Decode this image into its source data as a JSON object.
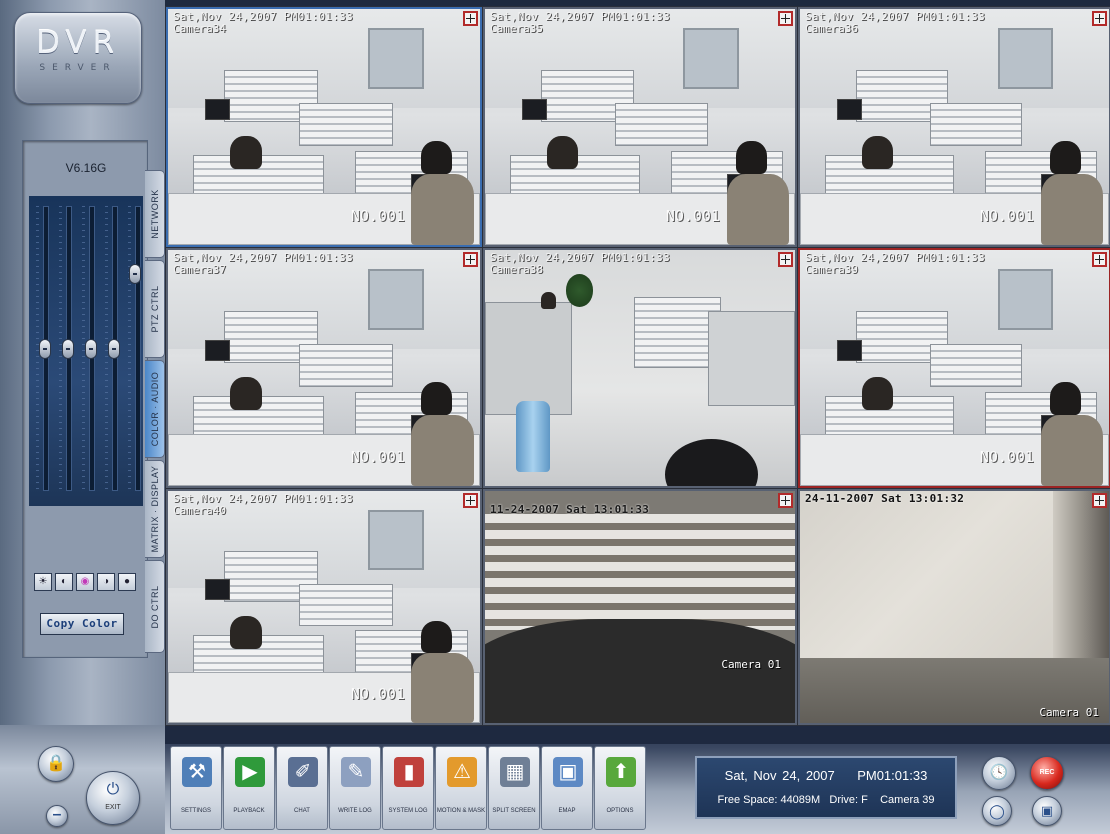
{
  "app": {
    "logo": {
      "title": "DVR",
      "subtitle": "SERVER"
    },
    "version": "V6.16G",
    "copy_color_label": "Copy Color"
  },
  "side_tabs": [
    {
      "label": "NETWORK"
    },
    {
      "label": "PTZ CTRL"
    },
    {
      "label": "COLOR · AUDIO",
      "active": true
    },
    {
      "label": "MATRIX · DISPLAY"
    },
    {
      "label": "DO CTRL"
    }
  ],
  "color_controls": [
    "brightness-icon",
    "contrast-icon",
    "hue-icon",
    "saturation-icon",
    "sharpness-icon"
  ],
  "sliders": {
    "brightness": 0.5,
    "contrast": 0.5,
    "saturation": 0.5,
    "hue": 0.5,
    "volume": 0.78
  },
  "cameras": [
    {
      "time": "Sat,Nov 24,2007 PM01:01:33",
      "name": "Camera34",
      "tag": "NO.001",
      "scene": "office"
    },
    {
      "time": "Sat,Nov 24,2007 PM01:01:33",
      "name": "Camera35",
      "tag": "NO.001",
      "scene": "office"
    },
    {
      "time": "Sat,Nov 24,2007 PM01:01:33",
      "name": "Camera36",
      "tag": "NO.001",
      "scene": "office"
    },
    {
      "time": "Sat,Nov 24,2007 PM01:01:33",
      "name": "Camera37",
      "tag": "NO.001",
      "scene": "office"
    },
    {
      "time": "Sat,Nov 24,2007 PM01:01:33",
      "name": "Camera38",
      "tag": "",
      "scene": "room"
    },
    {
      "time": "Sat,Nov 24,2007 PM01:01:33",
      "name": "Camera39",
      "tag": "NO.001",
      "scene": "office",
      "selected": true
    },
    {
      "time": "Sat,Nov 24,2007 PM01:01:33",
      "name": "Camera40",
      "tag": "NO.001",
      "scene": "office"
    },
    {
      "time": "11-24-2007 Sat 13:01:33",
      "name": "",
      "tag": "Camera 01",
      "scene": "blinds"
    },
    {
      "time": "24-11-2007 Sat 13:01:32",
      "name": "",
      "tag": "Camera 01",
      "scene": "wood"
    }
  ],
  "toolbar": [
    {
      "label": "SETTINGS",
      "icon": "tools-icon",
      "color": "#4f7fb8"
    },
    {
      "label": "PLAYBACK",
      "icon": "play-icon",
      "color": "#2f9a3b"
    },
    {
      "label": "CHAT",
      "icon": "microphone-icon",
      "color": "#5a6f93"
    },
    {
      "label": "WRITE LOG",
      "icon": "pen-icon",
      "color": "#8da0c0"
    },
    {
      "label": "SYSTEM LOG",
      "icon": "book-icon",
      "color": "#c0413c"
    },
    {
      "label": "MOTION & MASK",
      "icon": "motion-icon",
      "color": "#e39a2c"
    },
    {
      "label": "SPLIT SCREEN",
      "icon": "grid-icon",
      "color": "#6f7f96"
    },
    {
      "label": "EMAP",
      "icon": "map-icon",
      "color": "#5d89c4"
    },
    {
      "label": "OPTIONS",
      "icon": "arrow-up-icon",
      "color": "#58a83c"
    }
  ],
  "status": {
    "date": "Sat, Nov 24, 2007",
    "time": "PM01:01:33",
    "free_space": "Free Space: 44089M",
    "drive": "Drive: F",
    "camera": "Camera 39"
  },
  "bottom_left": {
    "exit_label": "EXIT"
  },
  "right_buttons": {
    "rec_label": "REC"
  }
}
